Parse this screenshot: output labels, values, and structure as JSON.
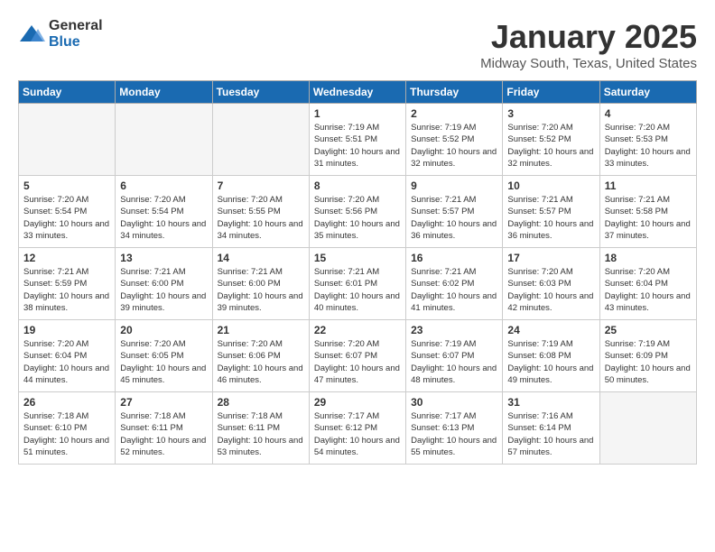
{
  "header": {
    "logo": {
      "general": "General",
      "blue": "Blue"
    },
    "title": "January 2025",
    "subtitle": "Midway South, Texas, United States"
  },
  "weekdays": [
    "Sunday",
    "Monday",
    "Tuesday",
    "Wednesday",
    "Thursday",
    "Friday",
    "Saturday"
  ],
  "weeks": [
    [
      {
        "day": "",
        "empty": true
      },
      {
        "day": "",
        "empty": true
      },
      {
        "day": "",
        "empty": true
      },
      {
        "day": "1",
        "sunrise": "7:19 AM",
        "sunset": "5:51 PM",
        "daylight": "10 hours and 31 minutes."
      },
      {
        "day": "2",
        "sunrise": "7:19 AM",
        "sunset": "5:52 PM",
        "daylight": "10 hours and 32 minutes."
      },
      {
        "day": "3",
        "sunrise": "7:20 AM",
        "sunset": "5:52 PM",
        "daylight": "10 hours and 32 minutes."
      },
      {
        "day": "4",
        "sunrise": "7:20 AM",
        "sunset": "5:53 PM",
        "daylight": "10 hours and 33 minutes."
      }
    ],
    [
      {
        "day": "5",
        "sunrise": "7:20 AM",
        "sunset": "5:54 PM",
        "daylight": "10 hours and 33 minutes."
      },
      {
        "day": "6",
        "sunrise": "7:20 AM",
        "sunset": "5:54 PM",
        "daylight": "10 hours and 34 minutes."
      },
      {
        "day": "7",
        "sunrise": "7:20 AM",
        "sunset": "5:55 PM",
        "daylight": "10 hours and 34 minutes."
      },
      {
        "day": "8",
        "sunrise": "7:20 AM",
        "sunset": "5:56 PM",
        "daylight": "10 hours and 35 minutes."
      },
      {
        "day": "9",
        "sunrise": "7:21 AM",
        "sunset": "5:57 PM",
        "daylight": "10 hours and 36 minutes."
      },
      {
        "day": "10",
        "sunrise": "7:21 AM",
        "sunset": "5:57 PM",
        "daylight": "10 hours and 36 minutes."
      },
      {
        "day": "11",
        "sunrise": "7:21 AM",
        "sunset": "5:58 PM",
        "daylight": "10 hours and 37 minutes."
      }
    ],
    [
      {
        "day": "12",
        "sunrise": "7:21 AM",
        "sunset": "5:59 PM",
        "daylight": "10 hours and 38 minutes."
      },
      {
        "day": "13",
        "sunrise": "7:21 AM",
        "sunset": "6:00 PM",
        "daylight": "10 hours and 39 minutes."
      },
      {
        "day": "14",
        "sunrise": "7:21 AM",
        "sunset": "6:00 PM",
        "daylight": "10 hours and 39 minutes."
      },
      {
        "day": "15",
        "sunrise": "7:21 AM",
        "sunset": "6:01 PM",
        "daylight": "10 hours and 40 minutes."
      },
      {
        "day": "16",
        "sunrise": "7:21 AM",
        "sunset": "6:02 PM",
        "daylight": "10 hours and 41 minutes."
      },
      {
        "day": "17",
        "sunrise": "7:20 AM",
        "sunset": "6:03 PM",
        "daylight": "10 hours and 42 minutes."
      },
      {
        "day": "18",
        "sunrise": "7:20 AM",
        "sunset": "6:04 PM",
        "daylight": "10 hours and 43 minutes."
      }
    ],
    [
      {
        "day": "19",
        "sunrise": "7:20 AM",
        "sunset": "6:04 PM",
        "daylight": "10 hours and 44 minutes."
      },
      {
        "day": "20",
        "sunrise": "7:20 AM",
        "sunset": "6:05 PM",
        "daylight": "10 hours and 45 minutes."
      },
      {
        "day": "21",
        "sunrise": "7:20 AM",
        "sunset": "6:06 PM",
        "daylight": "10 hours and 46 minutes."
      },
      {
        "day": "22",
        "sunrise": "7:20 AM",
        "sunset": "6:07 PM",
        "daylight": "10 hours and 47 minutes."
      },
      {
        "day": "23",
        "sunrise": "7:19 AM",
        "sunset": "6:07 PM",
        "daylight": "10 hours and 48 minutes."
      },
      {
        "day": "24",
        "sunrise": "7:19 AM",
        "sunset": "6:08 PM",
        "daylight": "10 hours and 49 minutes."
      },
      {
        "day": "25",
        "sunrise": "7:19 AM",
        "sunset": "6:09 PM",
        "daylight": "10 hours and 50 minutes."
      }
    ],
    [
      {
        "day": "26",
        "sunrise": "7:18 AM",
        "sunset": "6:10 PM",
        "daylight": "10 hours and 51 minutes."
      },
      {
        "day": "27",
        "sunrise": "7:18 AM",
        "sunset": "6:11 PM",
        "daylight": "10 hours and 52 minutes."
      },
      {
        "day": "28",
        "sunrise": "7:18 AM",
        "sunset": "6:11 PM",
        "daylight": "10 hours and 53 minutes."
      },
      {
        "day": "29",
        "sunrise": "7:17 AM",
        "sunset": "6:12 PM",
        "daylight": "10 hours and 54 minutes."
      },
      {
        "day": "30",
        "sunrise": "7:17 AM",
        "sunset": "6:13 PM",
        "daylight": "10 hours and 55 minutes."
      },
      {
        "day": "31",
        "sunrise": "7:16 AM",
        "sunset": "6:14 PM",
        "daylight": "10 hours and 57 minutes."
      },
      {
        "day": "",
        "empty": true
      }
    ]
  ],
  "labels": {
    "sunrise": "Sunrise:",
    "sunset": "Sunset:",
    "daylight": "Daylight:"
  }
}
